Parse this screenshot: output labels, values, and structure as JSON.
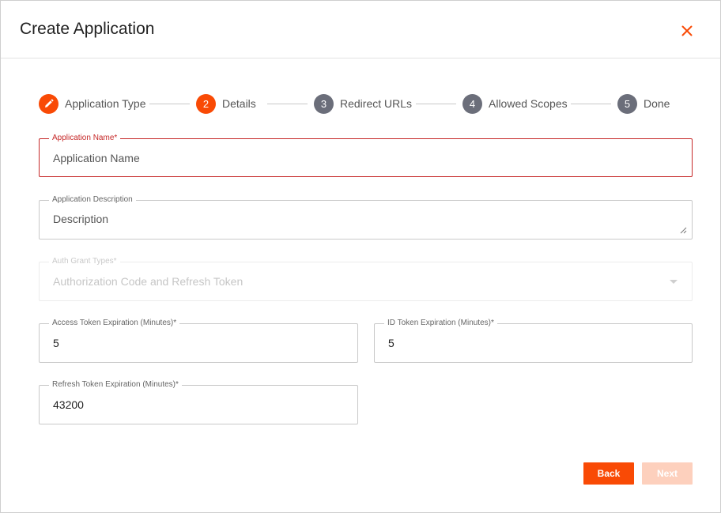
{
  "dialog": {
    "title": "Create Application",
    "close_icon": "close-icon"
  },
  "stepper": {
    "steps": [
      {
        "number": "",
        "label": "Application Type",
        "state": "edit",
        "icon": "pencil-icon"
      },
      {
        "number": "2",
        "label": "Details",
        "state": "active"
      },
      {
        "number": "3",
        "label": "Redirect URLs",
        "state": "pending"
      },
      {
        "number": "4",
        "label": "Allowed Scopes",
        "state": "pending"
      },
      {
        "number": "5",
        "label": "Done",
        "state": "pending"
      }
    ]
  },
  "form": {
    "app_name": {
      "label": "Application Name*",
      "placeholder": "Application Name",
      "value": ""
    },
    "app_description": {
      "label": "Application Description",
      "placeholder": "Description",
      "value": ""
    },
    "grant_types": {
      "label": "Auth Grant Types*",
      "value": "Authorization Code and Refresh Token"
    },
    "access_token_exp": {
      "label": "Access Token Expiration (Minutes)*",
      "value": "5"
    },
    "id_token_exp": {
      "label": "ID Token Expiration (Minutes)*",
      "value": "5"
    },
    "refresh_token_exp": {
      "label": "Refresh Token Expiration (Minutes)*",
      "value": "43200"
    }
  },
  "actions": {
    "back_label": "Back",
    "next_label": "Next"
  },
  "colors": {
    "accent": "#f94a05",
    "pending_step": "#6b6e7a",
    "error": "#c62828",
    "next_disabled": "#fdd0bd"
  }
}
